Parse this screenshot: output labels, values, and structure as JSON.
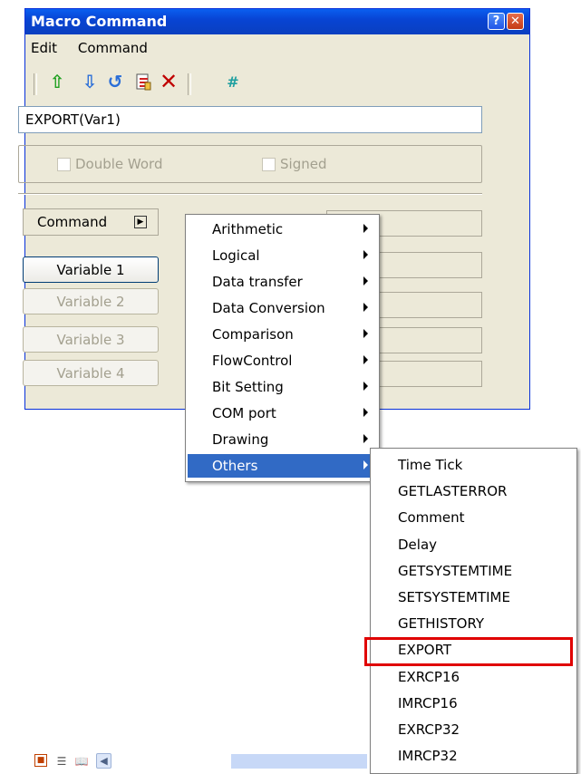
{
  "window": {
    "title": "Macro Command"
  },
  "menubar": {
    "edit": "Edit",
    "command": "Command"
  },
  "toolbar": {
    "hash": "#"
  },
  "command_text": "EXPORT(Var1)",
  "options": {
    "double_word": "Double Word",
    "signed": "Signed"
  },
  "command_label": "Command",
  "variables": [
    "Variable 1",
    "Variable 2",
    "Variable 3",
    "Variable 4"
  ],
  "menu": [
    {
      "label": "Arithmetic",
      "selected": false
    },
    {
      "label": "Logical",
      "selected": false
    },
    {
      "label": "Data transfer",
      "selected": false
    },
    {
      "label": "Data Conversion",
      "selected": false
    },
    {
      "label": "Comparison",
      "selected": false
    },
    {
      "label": "FlowControl",
      "selected": false
    },
    {
      "label": "Bit Setting",
      "selected": false
    },
    {
      "label": "COM port",
      "selected": false
    },
    {
      "label": "Drawing",
      "selected": false
    },
    {
      "label": "Others",
      "selected": true
    }
  ],
  "submenu": [
    "Time Tick",
    "GETLASTERROR",
    "Comment",
    "Delay",
    "GETSYSTEMTIME",
    "SETSYSTEMTIME",
    "GETHISTORY",
    "EXPORT",
    "EXRCP16",
    "IMRCP16",
    "EXRCP32",
    "IMRCP32"
  ],
  "highlighted_item": "EXPORT",
  "colors": {
    "highlight_border": "#e00000",
    "menu_selection": "#316ac5"
  }
}
